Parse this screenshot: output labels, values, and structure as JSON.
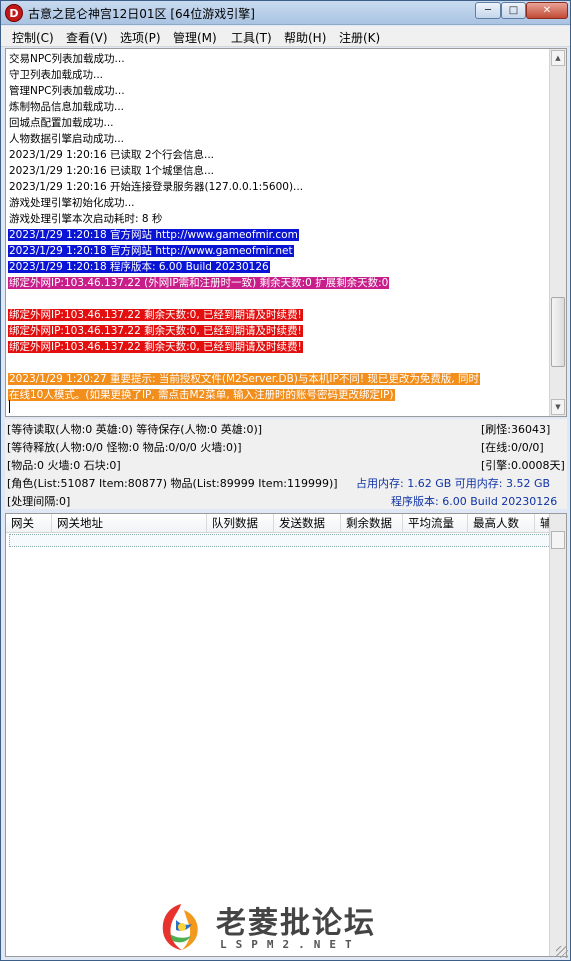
{
  "window": {
    "title": "古意之昆仑神宫12日01区 [64位游戏引擎]",
    "icon_letter": "D",
    "controls": [
      "─",
      "□",
      "✕"
    ]
  },
  "menu": [
    "控制(C)",
    "查看(V)",
    "选项(P)",
    "管理(M)",
    "工具(T)",
    "帮助(H)",
    "注册(K)"
  ],
  "log": {
    "lines": [
      {
        "text": "交易NPC列表加载成功...",
        "style": "normal"
      },
      {
        "text": "守卫列表加载成功...",
        "style": "normal"
      },
      {
        "text": "管理NPC列表加载成功...",
        "style": "normal"
      },
      {
        "text": "炼制物品信息加载成功...",
        "style": "normal"
      },
      {
        "text": "回城点配置加载成功...",
        "style": "normal"
      },
      {
        "text": "人物数据引擎启动成功...",
        "style": "normal"
      },
      {
        "text": "2023/1/29 1:20:16 已读取 2个行会信息...",
        "style": "normal"
      },
      {
        "text": "2023/1/29 1:20:16 已读取 1个城堡信息...",
        "style": "normal"
      },
      {
        "text": "2023/1/29 1:20:16 开始连接登录服务器(127.0.0.1:5600)...",
        "style": "normal"
      },
      {
        "text": "游戏处理引擎初始化成功...",
        "style": "normal"
      },
      {
        "text": "游戏处理引擎本次启动耗时: 8 秒",
        "style": "normal"
      },
      {
        "text": "2023/1/29 1:20:18 官方网站 http://www.gameofmir.com",
        "style": "blue"
      },
      {
        "text": "2023/1/29 1:20:18 官方网站 http://www.gameofmir.net",
        "style": "blue"
      },
      {
        "text": "2023/1/29 1:20:18 程序版本: 6.00 Build 20230126",
        "style": "blue"
      },
      {
        "text": "绑定外网IP:103.46.137.22 (外网IP需和注册时一致) 剩余天数:0 扩展剩余天数:0",
        "style": "magenta"
      },
      {
        "text": "",
        "style": "normal"
      },
      {
        "text": "绑定外网IP:103.46.137.22 剩余天数:0, 已经到期请及时续费!",
        "style": "red"
      },
      {
        "text": "绑定外网IP:103.46.137.22 剩余天数:0, 已经到期请及时续费!",
        "style": "red"
      },
      {
        "text": "绑定外网IP:103.46.137.22 剩余天数:0, 已经到期请及时续费!",
        "style": "red"
      },
      {
        "text": "",
        "style": "normal"
      },
      {
        "text": "2023/1/29 1:20:27 重要提示: 当前授权文件(M2Server.DB)与本机IP不同! 现已更改为免费版, 同时",
        "style": "orange"
      },
      {
        "text": "在线10人模式。(如果更换了IP, 需点击M2菜单, 输入注册时的账号密码更改绑定IP)",
        "style": "orange"
      }
    ]
  },
  "status": {
    "row1_left": "[等待读取(人物:0 英雄:0) 等待保存(人物:0 英雄:0)]",
    "row1_right": "[刷怪:36043]",
    "row2_left": "[等待释放(人物:0/0 怪物:0 物品:0/0/0 火墙:0)]",
    "row2_right": "[在线:0/0/0]",
    "row3_left": "[物品:0 火墙:0 石块:0]",
    "row3_right": "[引擎:0.0008天]",
    "row4_left": "[角色(List:51087 Item:80877) 物品(List:89999 Item:119999)]",
    "row4_right": "占用内存: 1.62 GB 可用内存: 3.52 GB",
    "row5_left": "[处理间隔:0]",
    "row5_right": "程序版本: 6.00 Build 20230126"
  },
  "table": {
    "columns": [
      "网关",
      "网关地址",
      "队列数据",
      "发送数据",
      "剩余数据",
      "平均流量",
      "最高人数",
      "辅"
    ]
  },
  "watermark": {
    "main": "老菱批论坛",
    "sub": "LSPM2.NET"
  }
}
